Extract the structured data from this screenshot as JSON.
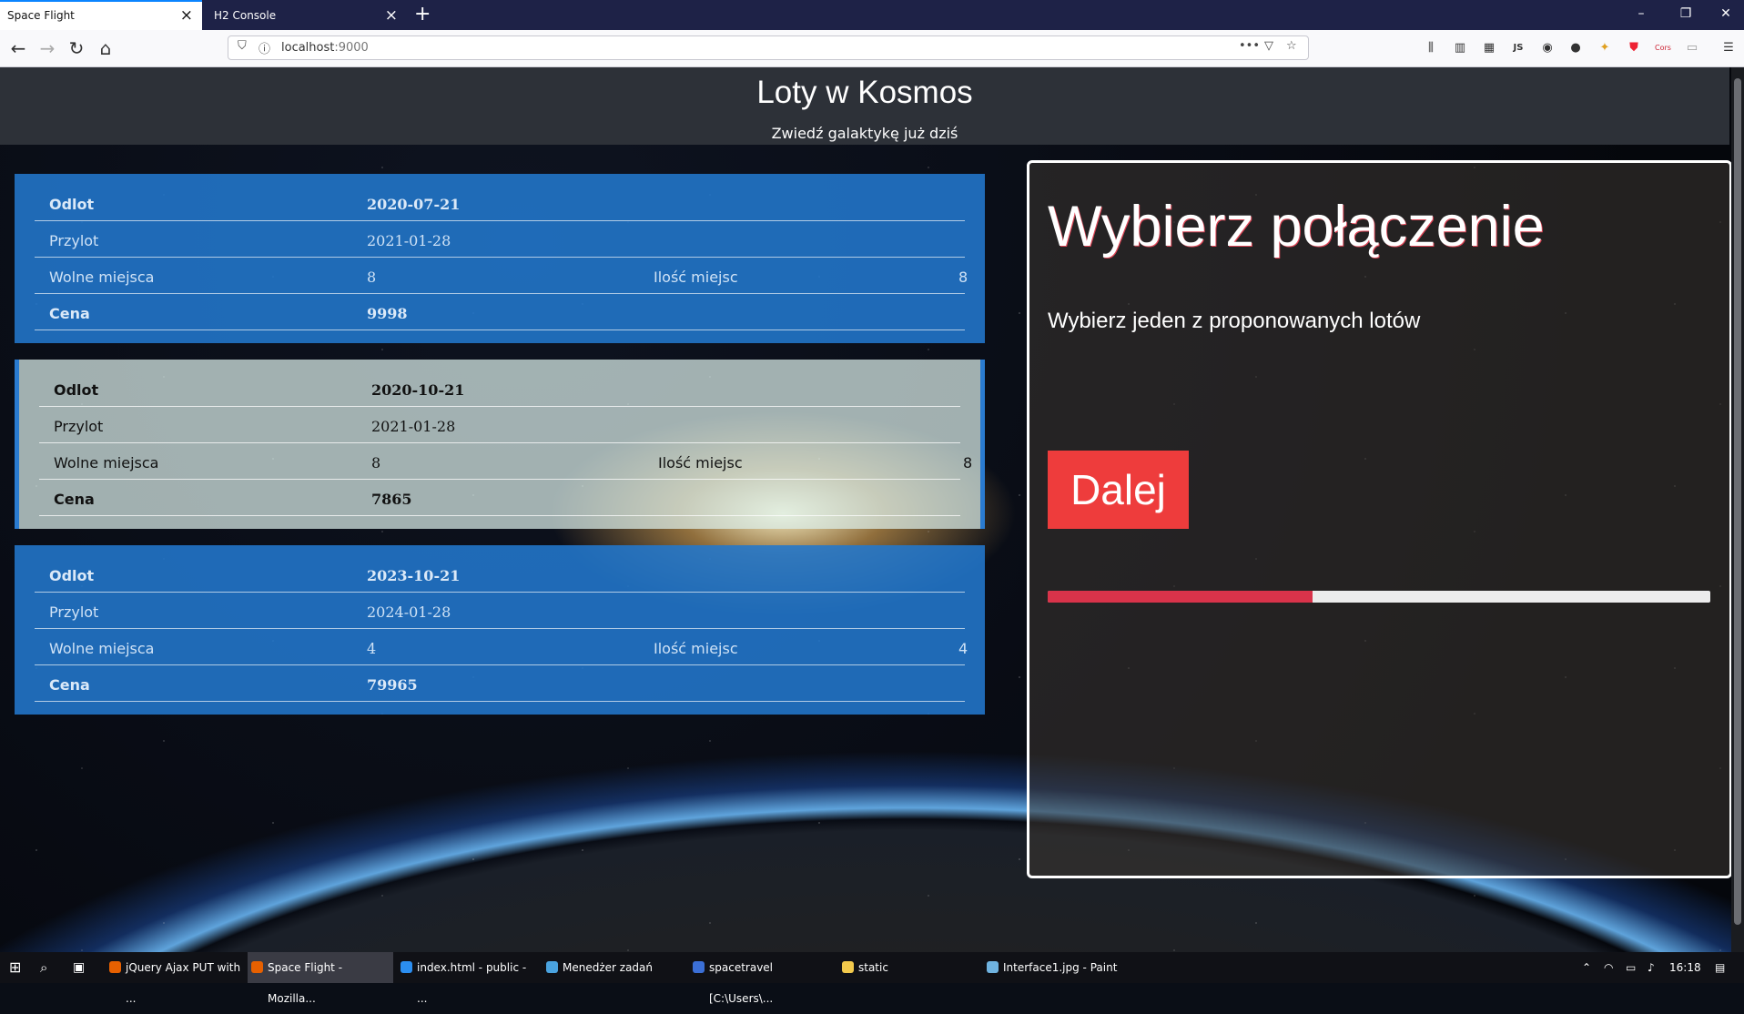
{
  "browser": {
    "tabs": [
      {
        "label": "Space Flight",
        "active": true
      },
      {
        "label": "H2 Console",
        "active": false
      }
    ],
    "new_tab_symbol": "+",
    "window_controls": [
      "–",
      "❐",
      "✕"
    ],
    "url_host": "localhost",
    "url_port": ":9000",
    "toolbar_icons": [
      "library-icon",
      "sidebar-icon",
      "barcode-icon",
      "js-icon",
      "account-icon",
      "extension-icon",
      "extension-icon",
      "shield-icon",
      "cors-icon",
      "extension-icon",
      "menu-icon"
    ],
    "toolbar_js_label": "JS",
    "toolbar_cors_label": "Cors"
  },
  "header": {
    "title": "Loty w Kosmos",
    "subtitle": "Zwiedź galaktykę już dziś"
  },
  "flights": [
    {
      "labels": {
        "departure": "Odlot",
        "arrival": "Przylot",
        "free": "Wolne miejsca",
        "seats": "Ilość miejsc",
        "price": "Cena"
      },
      "departure": "2020-07-21",
      "arrival": "2021-01-28",
      "free": "8",
      "seats": "8",
      "price": "9998",
      "selected": false
    },
    {
      "labels": {
        "departure": "Odlot",
        "arrival": "Przylot",
        "free": "Wolne miejsca",
        "seats": "Ilość miejsc",
        "price": "Cena"
      },
      "departure": "2020-10-21",
      "arrival": "2021-01-28",
      "free": "8",
      "seats": "8",
      "price": "7865",
      "selected": true
    },
    {
      "labels": {
        "departure": "Odlot",
        "arrival": "Przylot",
        "free": "Wolne miejsca",
        "seats": "Ilość miejsc",
        "price": "Cena"
      },
      "departure": "2023-10-21",
      "arrival": "2024-01-28",
      "free": "4",
      "seats": "4",
      "price": "79965",
      "selected": false
    }
  ],
  "panel": {
    "heading": "Wybierz połączenie",
    "description": "Wybierz jeden z proponowanych lotów",
    "next_button": "Dalej",
    "progress_fraction": 0.4
  },
  "taskbar": {
    "items": [
      {
        "label": "jQuery Ajax PUT with ...",
        "color": "#e66000",
        "active": false
      },
      {
        "label": "Space Flight - Mozilla...",
        "color": "#e66000",
        "active": true
      },
      {
        "label": "index.html - public - ...",
        "color": "#2b8ef0",
        "active": false
      },
      {
        "label": "Menedżer zadań",
        "color": "#4aa3df",
        "active": false
      },
      {
        "label": "spacetravel [C:\\Users\\...",
        "color": "#3b6fd6",
        "active": false
      },
      {
        "label": "static",
        "color": "#f2c94c",
        "active": false
      },
      {
        "label": "Interface1.jpg - Paint",
        "color": "#6fb3e0",
        "active": false
      }
    ],
    "clock": "16:18"
  },
  "colors": {
    "header_bg": "#2d3138",
    "card_blue": "#2278cd",
    "accent_red": "#ee3c3c",
    "progress_red": "#d9334a"
  }
}
